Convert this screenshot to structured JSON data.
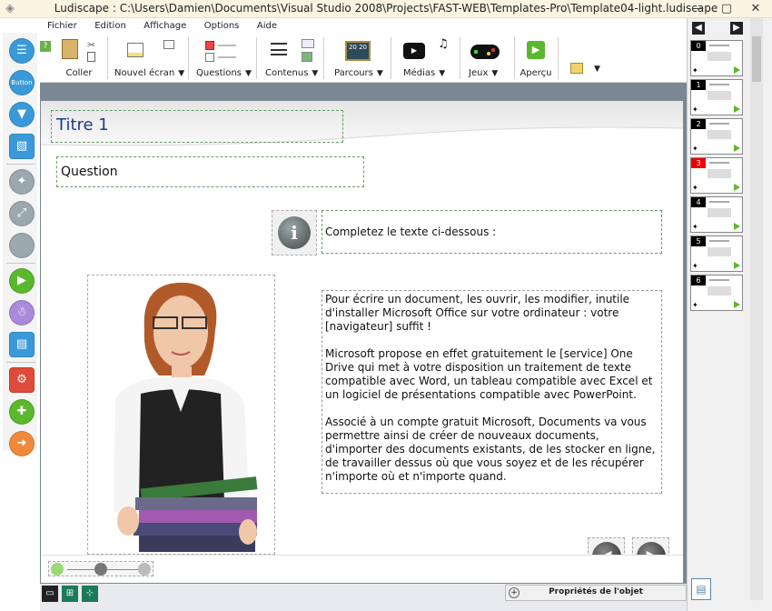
{
  "window": {
    "title": "Ludiscape : C:\\Users\\Damien\\Documents\\Visual Studio 2008\\Projects\\FAST-WEB\\Templates-Pro\\Template04-light.ludiscape",
    "minimize": "—",
    "maximize": "▢",
    "close": "✕"
  },
  "menu": [
    "Fichier",
    "Edition",
    "Affichage",
    "Options",
    "Aide"
  ],
  "ribbon": {
    "help_badge": "?",
    "paste_label": "Coller",
    "new_screen_label": "Nouvel écran",
    "questions_label": "Questions",
    "contents_label": "Contenus",
    "paths_label": "Parcours",
    "media_label": "Médias",
    "games_label": "Jeux",
    "preview_label": "Aperçu",
    "paths_icon_text": "20 20"
  },
  "left_tools": {
    "button_label": "Button"
  },
  "page": {
    "title": "Titre 1",
    "question": "Question",
    "info_glyph": "i",
    "instruction": "Completez le texte ci-dessous :",
    "paragraphs": [
      "Pour écrire un document, les ouvrir, les modifier, inutile d'installer Microsoft Office sur votre ordinateur : votre [navigateur] suffit !",
      "Microsoft propose en effet gratuitement le [service] One Drive qui met à votre disposition un traitement de texte compatible avec Word, un tableau compatible avec Excel et un logiciel de présentations compatible avec PowerPoint.",
      "Associé à un compte gratuit Microsoft, Documents va vous permettre ainsi de créer de nouveaux documents, d'importer des documents existants, de les stocker en ligne, de travailler dessus où que vous soyez et de les récupérer n'importe où et n'importe quand."
    ],
    "prev_glyph": "◀",
    "next_glyph": "▶"
  },
  "status": {
    "properties_label": "Propriétés de l'objet",
    "plus": "+"
  },
  "slides": {
    "prev": "◀",
    "next": "▶",
    "items": [
      {
        "num": "0",
        "active": false
      },
      {
        "num": "1",
        "active": false
      },
      {
        "num": "2",
        "active": false
      },
      {
        "num": "3",
        "active": true
      },
      {
        "num": "4",
        "active": false
      },
      {
        "num": "5",
        "active": false
      },
      {
        "num": "6",
        "active": false
      }
    ]
  },
  "colors": {
    "title_blue": "#1f3b86",
    "workspace_gray": "#7c8794",
    "active_slide": "#e00000",
    "play_green": "#5ab82c"
  }
}
